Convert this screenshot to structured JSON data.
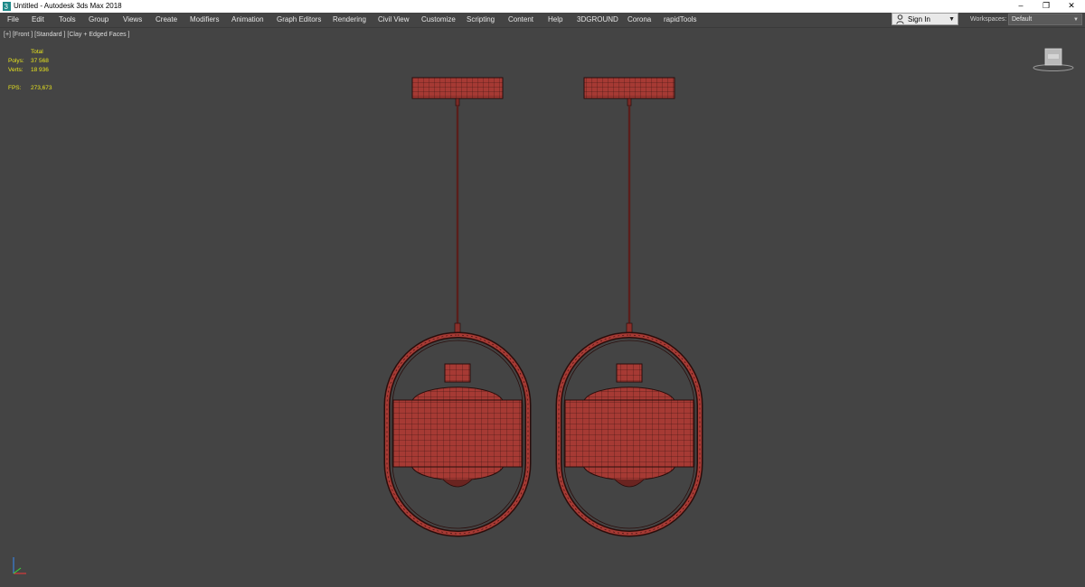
{
  "window": {
    "title": "Untitled - Autodesk 3ds Max 2018",
    "controls": {
      "minimize": "–",
      "restore": "❐",
      "close": "✕"
    }
  },
  "menu": {
    "items": [
      "File",
      "Edit",
      "Tools",
      "Group",
      "Views",
      "Create",
      "Modifiers",
      "Animation",
      "Graph Editors",
      "Rendering",
      "Civil View",
      "Customize",
      "Scripting",
      "Content",
      "Help",
      "3DGROUND",
      "Corona",
      "rapidTools"
    ]
  },
  "account": {
    "sign_in_label": "Sign In"
  },
  "workspaces": {
    "label": "Workspaces:",
    "value": "Default"
  },
  "viewport": {
    "label_parts": [
      "[+]",
      "[Front ]",
      "[Standard ]",
      "[Clay + Edged Faces ]"
    ],
    "stats": {
      "header": "Total",
      "polys_label": "Polys:",
      "polys_value": "37 568",
      "verts_label": "Verts:",
      "verts_value": "18 936",
      "fps_label": "FPS:",
      "fps_value": "273,673"
    }
  },
  "colors": {
    "viewport_bg": "#444444",
    "mesh_fill": "#a63a34",
    "mesh_wire": "#2a0d0b",
    "stats_text": "#e8e41e"
  },
  "icons": {
    "app": "3dsmax-icon",
    "sign_in": "user-icon",
    "dropdown": "chevron-down-icon",
    "viewcube": "viewcube-icon",
    "axis": "axis-tripod-icon"
  }
}
